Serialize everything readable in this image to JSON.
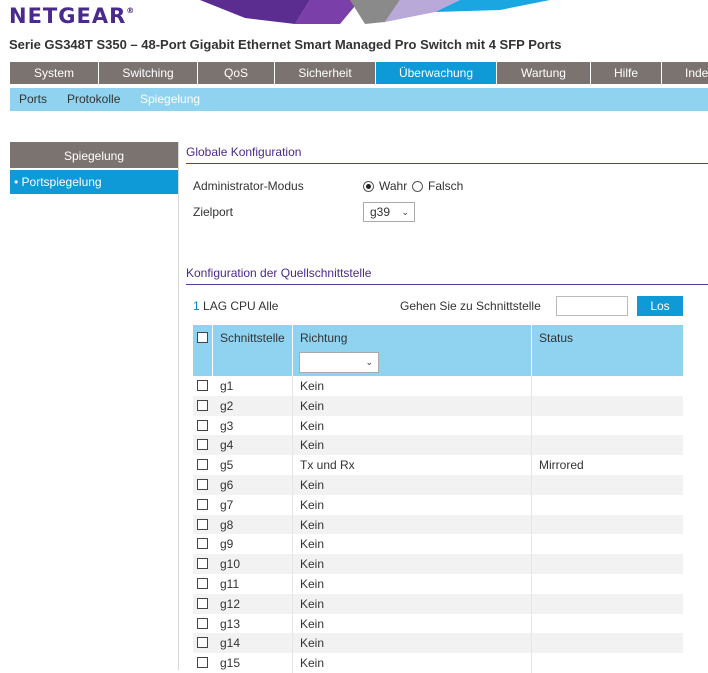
{
  "brand": "NETGEAR",
  "product_title": "Serie GS348T S350 – 48-Port Gigabit Ethernet Smart Managed Pro Switch mit 4 SFP Ports",
  "main_nav": [
    {
      "label": "System",
      "active": false
    },
    {
      "label": "Switching",
      "active": false
    },
    {
      "label": "QoS",
      "active": false
    },
    {
      "label": "Sicherheit",
      "active": false
    },
    {
      "label": "Überwachung",
      "active": true
    },
    {
      "label": "Wartung",
      "active": false
    },
    {
      "label": "Hilfe",
      "active": false
    },
    {
      "label": "Inde",
      "active": false
    }
  ],
  "sub_nav": [
    {
      "label": "Ports",
      "active": false
    },
    {
      "label": "Protokolle",
      "active": false
    },
    {
      "label": "Spiegelung",
      "active": true
    }
  ],
  "left_menu": {
    "title": "Spiegelung",
    "items": [
      {
        "label": "• Portspiegelung",
        "active": true
      }
    ]
  },
  "global_config": {
    "title": "Globale Konfiguration",
    "admin_mode_label": "Administrator-Modus",
    "admin_mode_options": [
      {
        "label": "Wahr",
        "checked": true
      },
      {
        "label": "Falsch",
        "checked": false
      }
    ],
    "target_port_label": "Zielport",
    "target_port_value": "g39"
  },
  "source_config": {
    "title": "Konfiguration der Quellschnittstelle",
    "filter_links": [
      "1",
      "LAG",
      "CPU",
      "Alle"
    ],
    "goto_label": "Gehen Sie zu Schnittstelle",
    "goto_value": "",
    "goto_button": "Los",
    "columns": [
      "Schnittstelle",
      "Richtung",
      "Status"
    ],
    "direction_filter_value": "",
    "rows": [
      {
        "port": "g1",
        "direction": "Kein",
        "status": ""
      },
      {
        "port": "g2",
        "direction": "Kein",
        "status": ""
      },
      {
        "port": "g3",
        "direction": "Kein",
        "status": ""
      },
      {
        "port": "g4",
        "direction": "Kein",
        "status": ""
      },
      {
        "port": "g5",
        "direction": "Tx und Rx",
        "status": "Mirrored"
      },
      {
        "port": "g6",
        "direction": "Kein",
        "status": ""
      },
      {
        "port": "g7",
        "direction": "Kein",
        "status": ""
      },
      {
        "port": "g8",
        "direction": "Kein",
        "status": ""
      },
      {
        "port": "g9",
        "direction": "Kein",
        "status": ""
      },
      {
        "port": "g10",
        "direction": "Kein",
        "status": ""
      },
      {
        "port": "g11",
        "direction": "Kein",
        "status": ""
      },
      {
        "port": "g12",
        "direction": "Kein",
        "status": ""
      },
      {
        "port": "g13",
        "direction": "Kein",
        "status": ""
      },
      {
        "port": "g14",
        "direction": "Kein",
        "status": ""
      },
      {
        "port": "g15",
        "direction": "Kein",
        "status": ""
      }
    ]
  },
  "colors": {
    "nav_gray": "#7b7370",
    "nav_active": "#0e9ad7",
    "subnav_bg": "#8fd3f1",
    "brand_purple": "#4a2a8c"
  }
}
